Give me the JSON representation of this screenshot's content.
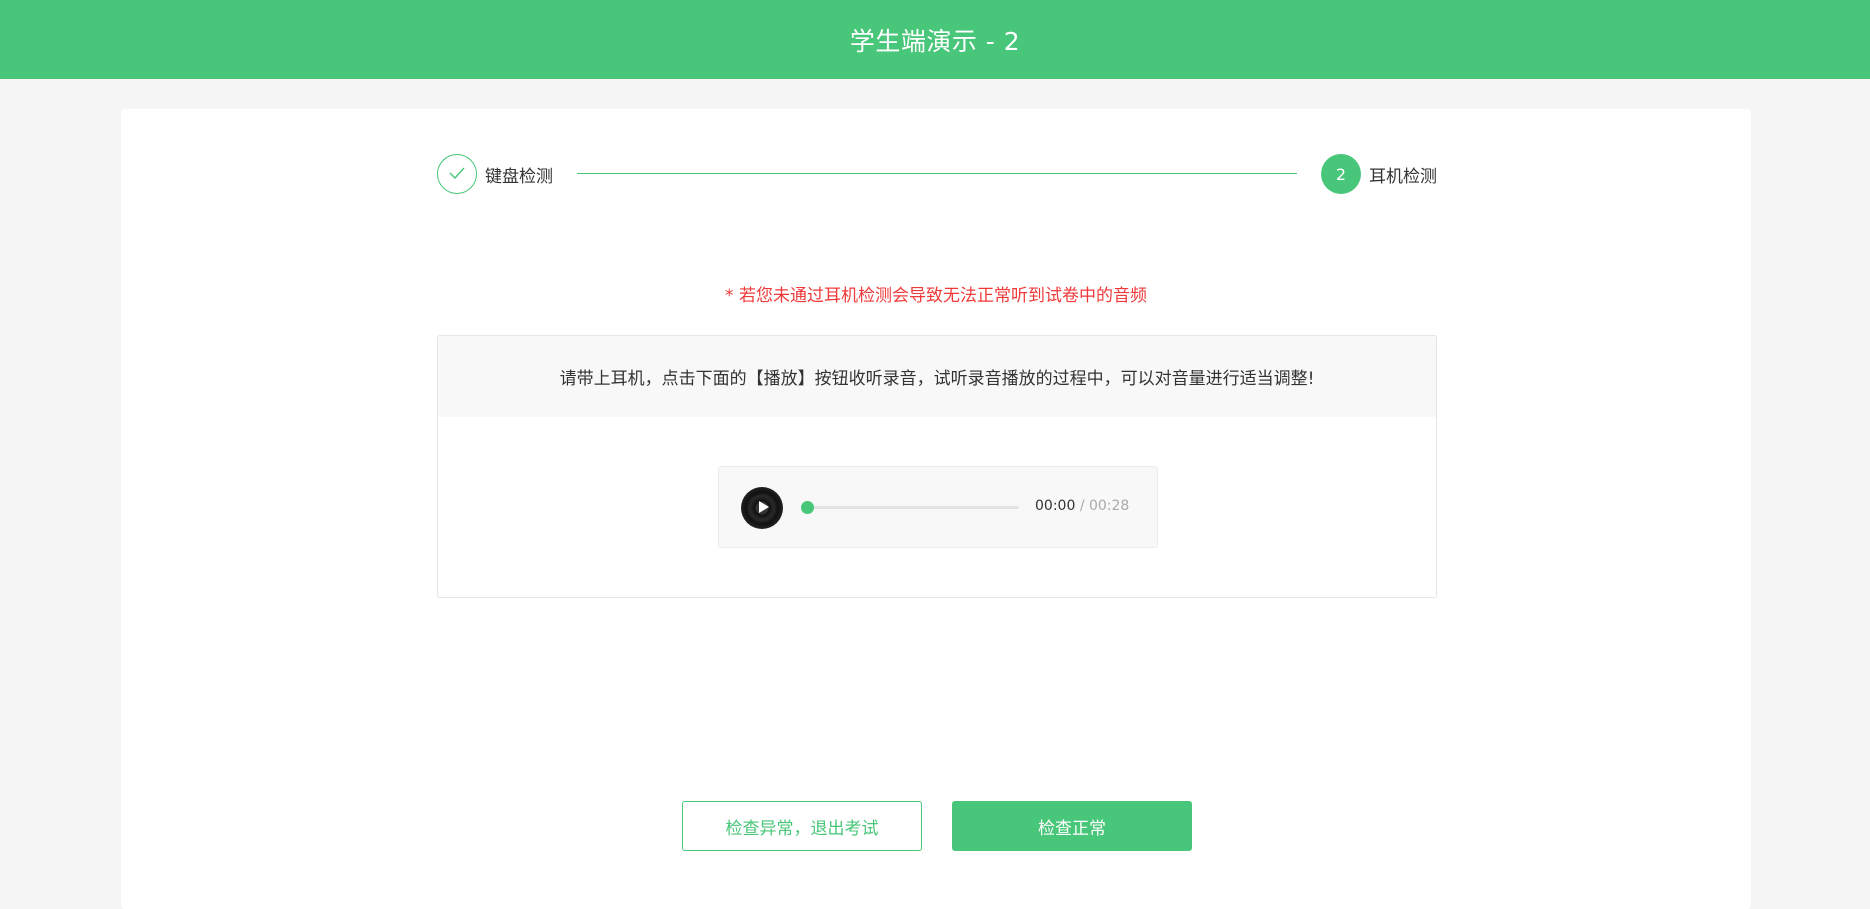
{
  "header": {
    "title": "学生端演示 - 2"
  },
  "steps": [
    {
      "label": "键盘检测",
      "status": "done",
      "icon": "check-icon"
    },
    {
      "label": "耳机检测",
      "status": "active",
      "number": "2"
    }
  ],
  "warning": "* 若您未通过耳机检测会导致无法正常听到试卷中的音频",
  "test": {
    "instruction": "请带上耳机，点击下面的【播放】按钮收听录音，试听录音播放的过程中，可以对音量进行适当调整!"
  },
  "player": {
    "current_time": "00:00",
    "separator": "/",
    "duration": "00:28",
    "progress": 0.02,
    "play_icon": "play-icon"
  },
  "buttons": {
    "abnormal_label": "检查异常，退出考试",
    "normal_label": "检查正常"
  },
  "colors": {
    "accent": "#48c679",
    "warning": "#f03a3a"
  }
}
